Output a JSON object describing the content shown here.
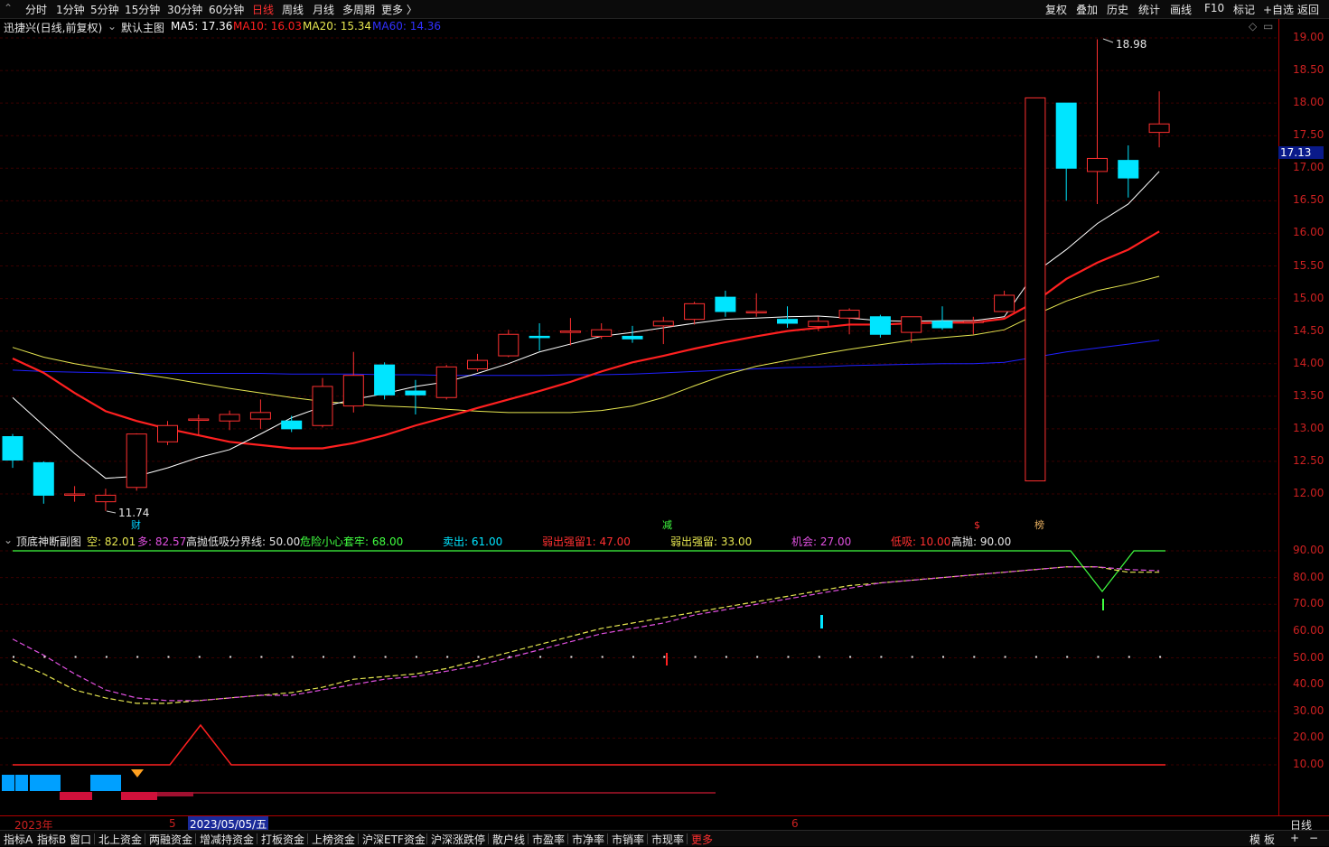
{
  "period_tabs": [
    "分时",
    "1分钟",
    "5分钟",
    "15分钟",
    "30分钟",
    "60分钟",
    "日线",
    "周线",
    "月线",
    "多周期",
    "更多 〉"
  ],
  "active_period": "日线",
  "right_tools": [
    "复权",
    "叠加",
    "历史",
    "统计",
    "画线",
    "F10",
    "标记",
    "+自选",
    "返回"
  ],
  "main": {
    "title": "迅捷兴(日线,前复权)",
    "indicator": "默认主图",
    "ma5": "MA5: 17.36",
    "ma10": "MA10: 16.03",
    "ma20": "MA20: 15.34",
    "ma60": "MA60: 14.36",
    "high_label": "18.98",
    "low_label": "11.74",
    "markers": [
      "财",
      "减",
      "$",
      "榜"
    ],
    "current_price": "17.13",
    "colors": {
      "ma5": "#ffffff",
      "ma10": "#ff2020",
      "ma20": "#e6e650",
      "ma60": "#2020ff",
      "up": "#ff3030",
      "down": "#00e5ff"
    }
  },
  "price_ticks": [
    "19.00",
    "18.50",
    "18.00",
    "17.50",
    "17.00",
    "16.50",
    "16.00",
    "15.50",
    "15.00",
    "14.50",
    "14.00",
    "13.50",
    "13.00",
    "12.50",
    "12.00"
  ],
  "sub": {
    "title": "顶底神断副图",
    "kong": "空: 82.01",
    "duo": "多: 82.57",
    "jie": "高抛低吸分界线: 50.00",
    "wei": "危险小心套牢: 68.00",
    "mai": "卖出: 61.00",
    "ruo1": "弱出强留1: 47.00",
    "ruo": "弱出强留: 33.00",
    "ji": "机会: 27.00",
    "di": "低吸: 10.00",
    "gao": "高抛: 90.00"
  },
  "sub_ticks": [
    "90.00",
    "80.00",
    "70.00",
    "60.00",
    "50.00",
    "40.00",
    "30.00",
    "20.00",
    "10.00"
  ],
  "dates": {
    "year": "2023年",
    "m5": "5",
    "cursor": "2023/05/05/五",
    "m6": "6",
    "period": "日线"
  },
  "bottom_tabs": [
    "指标A",
    "指标B",
    "窗口",
    "北上资金",
    "两融资金",
    "增减持资金",
    "打板资金",
    "上榜资金",
    "沪深ETF资金",
    "沪深涨跌停",
    "散户线",
    "市盈率",
    "市净率",
    "市销率",
    "市现率",
    "更多"
  ],
  "bottom_right": [
    "模",
    "板",
    "+",
    "−"
  ],
  "chart_data": {
    "type": "candlestick",
    "x": [
      "d1",
      "d2",
      "d3",
      "d4",
      "d5",
      "d6",
      "d7",
      "d8",
      "d9",
      "d10",
      "d11",
      "d12",
      "d13",
      "d14",
      "d15",
      "d16",
      "d17",
      "d18",
      "d19",
      "d20",
      "d21",
      "d22",
      "d23",
      "d24",
      "d25",
      "d26",
      "d27",
      "d28",
      "d29",
      "d30",
      "d31",
      "d32",
      "d33",
      "d34",
      "d35",
      "d36",
      "d37",
      "d38"
    ],
    "candles": [
      [
        12.88,
        12.52,
        12.92,
        12.4
      ],
      [
        12.48,
        11.98,
        12.5,
        11.85
      ],
      [
        12.0,
        12.0,
        12.12,
        11.88
      ],
      [
        11.88,
        11.98,
        12.08,
        11.74
      ],
      [
        12.1,
        12.92,
        12.93,
        12.05
      ],
      [
        12.8,
        13.05,
        13.12,
        12.75
      ],
      [
        13.15,
        13.15,
        13.22,
        12.9
      ],
      [
        13.12,
        13.22,
        13.28,
        12.98
      ],
      [
        13.15,
        13.25,
        13.45,
        13.0
      ],
      [
        13.12,
        13.0,
        13.2,
        12.95
      ],
      [
        13.05,
        13.65,
        13.78,
        13.02
      ],
      [
        13.35,
        13.82,
        14.18,
        13.25
      ],
      [
        13.98,
        13.52,
        14.02,
        13.45
      ],
      [
        13.58,
        13.52,
        13.75,
        13.22
      ],
      [
        13.48,
        13.95,
        13.98,
        13.45
      ],
      [
        13.92,
        14.05,
        14.15,
        13.88
      ],
      [
        14.12,
        14.45,
        14.52,
        14.1
      ],
      [
        14.42,
        14.4,
        14.62,
        14.2
      ],
      [
        14.5,
        14.5,
        14.7,
        14.28
      ],
      [
        14.42,
        14.52,
        14.62,
        14.38
      ],
      [
        14.42,
        14.38,
        14.58,
        14.32
      ],
      [
        14.58,
        14.65,
        14.72,
        14.3
      ],
      [
        14.68,
        14.92,
        14.95,
        14.6
      ],
      [
        15.02,
        14.8,
        15.12,
        14.72
      ],
      [
        14.8,
        14.8,
        15.08,
        14.72
      ],
      [
        14.68,
        14.62,
        14.88,
        14.55
      ],
      [
        14.57,
        14.65,
        14.72,
        14.5
      ],
      [
        14.7,
        14.82,
        14.85,
        14.45
      ],
      [
        14.72,
        14.45,
        14.75,
        14.4
      ],
      [
        14.48,
        14.72,
        14.72,
        14.32
      ],
      [
        14.65,
        14.55,
        14.88,
        14.52
      ],
      [
        14.65,
        14.65,
        14.72,
        14.45
      ],
      [
        14.8,
        15.05,
        15.12,
        14.8
      ],
      [
        12.2,
        18.08,
        18.08,
        12.2
      ],
      [
        18.0,
        17.0,
        18.0,
        16.5
      ],
      [
        16.95,
        17.15,
        18.98,
        16.45
      ],
      [
        17.12,
        16.85,
        17.35,
        16.55
      ],
      [
        17.55,
        17.68,
        18.18,
        17.32
      ]
    ],
    "ma5": [
      13.48,
      13.05,
      12.62,
      12.24,
      12.27,
      12.4,
      12.56,
      12.68,
      12.92,
      13.17,
      13.34,
      13.45,
      13.54,
      13.65,
      13.72,
      13.85,
      14.0,
      14.18,
      14.3,
      14.42,
      14.48,
      14.55,
      14.62,
      14.68,
      14.7,
      14.72,
      14.73,
      14.7,
      14.66,
      14.65,
      14.66,
      14.66,
      14.72,
      15.4,
      15.75,
      16.15,
      16.45,
      16.95
    ],
    "ma10": [
      14.08,
      13.86,
      13.55,
      13.27,
      13.12,
      13.0,
      12.9,
      12.8,
      12.75,
      12.7,
      12.7,
      12.78,
      12.9,
      13.05,
      13.18,
      13.32,
      13.45,
      13.58,
      13.72,
      13.88,
      14.02,
      14.12,
      14.23,
      14.33,
      14.42,
      14.5,
      14.55,
      14.6,
      14.6,
      14.62,
      14.63,
      14.63,
      14.69,
      14.95,
      15.3,
      15.55,
      15.75,
      16.03
    ],
    "ma20": [
      14.25,
      14.1,
      14.0,
      13.92,
      13.85,
      13.78,
      13.7,
      13.62,
      13.55,
      13.48,
      13.42,
      13.38,
      13.35,
      13.33,
      13.3,
      13.27,
      13.25,
      13.25,
      13.25,
      13.28,
      13.35,
      13.48,
      13.66,
      13.83,
      13.96,
      14.05,
      14.14,
      14.22,
      14.29,
      14.36,
      14.4,
      14.44,
      14.52,
      14.75,
      14.96,
      15.12,
      15.22,
      15.34
    ],
    "ma60": [
      13.9,
      13.88,
      13.87,
      13.86,
      13.85,
      13.85,
      13.85,
      13.85,
      13.85,
      13.84,
      13.84,
      13.84,
      13.83,
      13.83,
      13.82,
      13.82,
      13.82,
      13.82,
      13.83,
      13.83,
      13.84,
      13.86,
      13.88,
      13.9,
      13.92,
      13.94,
      13.95,
      13.97,
      13.98,
      13.99,
      14.0,
      14.0,
      14.02,
      14.1,
      14.18,
      14.24,
      14.3,
      14.36
    ],
    "sub_kong": [
      49,
      44,
      38,
      35,
      33,
      33,
      34,
      35,
      36,
      37,
      39,
      42,
      43,
      44,
      46,
      49,
      52,
      55,
      58,
      61,
      63,
      65,
      67,
      69,
      71,
      73,
      75,
      77,
      78,
      79,
      80,
      81,
      82,
      83,
      84,
      84,
      82,
      82.01
    ],
    "sub_duo": [
      57,
      51,
      44,
      38,
      35,
      34,
      34,
      35,
      36,
      36,
      38,
      40,
      42,
      43,
      45,
      47,
      50,
      53,
      56,
      59,
      61,
      63,
      66,
      68,
      70,
      72,
      74,
      76,
      78,
      79,
      80,
      81,
      82,
      83,
      84,
      84,
      83,
      82.57
    ],
    "ylim_main": [
      11.4,
      19.7
    ],
    "ylim_sub": [
      0,
      95
    ]
  }
}
